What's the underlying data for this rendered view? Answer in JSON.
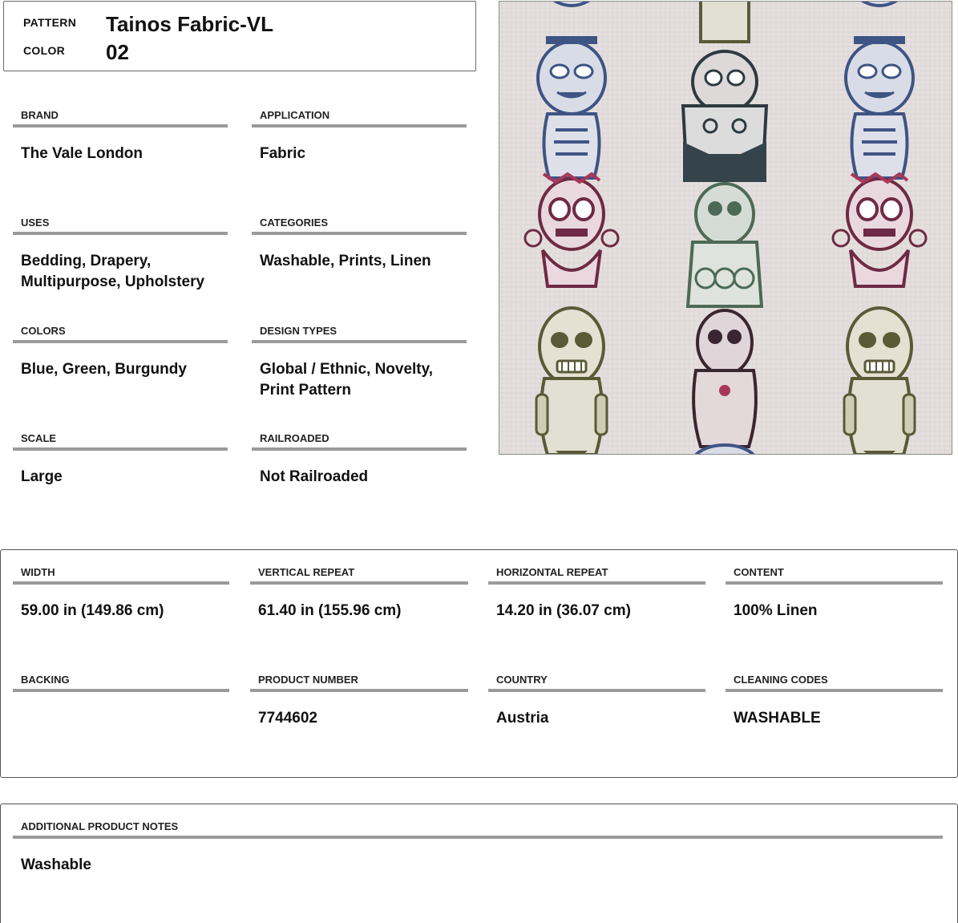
{
  "header": {
    "pattern_label": "PATTERN",
    "pattern_value": "Tainos Fabric-VL",
    "color_label": "COLOR",
    "color_value": "02"
  },
  "attributes": {
    "brand": {
      "label": "BRAND",
      "value": "The Vale London"
    },
    "application": {
      "label": "APPLICATION",
      "value": "Fabric"
    },
    "uses": {
      "label": "USES",
      "value": "Bedding, Drapery, Multipurpose, Upholstery"
    },
    "categories": {
      "label": "CATEGORIES",
      "value": "Washable, Prints, Linen"
    },
    "colors": {
      "label": "COLORS",
      "value": "Blue, Green, Burgundy"
    },
    "design_types": {
      "label": "DESIGN TYPES",
      "value": "Global / Ethnic, Novelty, Print Pattern"
    },
    "scale": {
      "label": "SCALE",
      "value": "Large"
    },
    "railroaded": {
      "label": "RAILROADED",
      "value": "Not Railroaded"
    }
  },
  "specs": {
    "width": {
      "label": "WIDTH",
      "value": "59.00 in (149.86 cm)"
    },
    "vertical_repeat": {
      "label": "VERTICAL REPEAT",
      "value": "61.40 in (155.96 cm)"
    },
    "horizontal_repeat": {
      "label": "HORIZONTAL REPEAT",
      "value": "14.20 in (36.07 cm)"
    },
    "content": {
      "label": "CONTENT",
      "value": "100% Linen"
    },
    "backing": {
      "label": "BACKING",
      "value": ""
    },
    "product_number": {
      "label": "PRODUCT NUMBER",
      "value": "7744602"
    },
    "country": {
      "label": "COUNTRY",
      "value": "Austria"
    },
    "cleaning_codes": {
      "label": "CLEANING CODES",
      "value": "WASHABLE"
    }
  },
  "notes": {
    "label": "ADDITIONAL PRODUCT NOTES",
    "value": "Washable"
  },
  "swatch": {
    "background": "#e5e0df",
    "colors": {
      "blue": "#4a5f8a",
      "green": "#5f7a66",
      "burgundy": "#6e2a45",
      "olive": "#6b6a45"
    }
  }
}
